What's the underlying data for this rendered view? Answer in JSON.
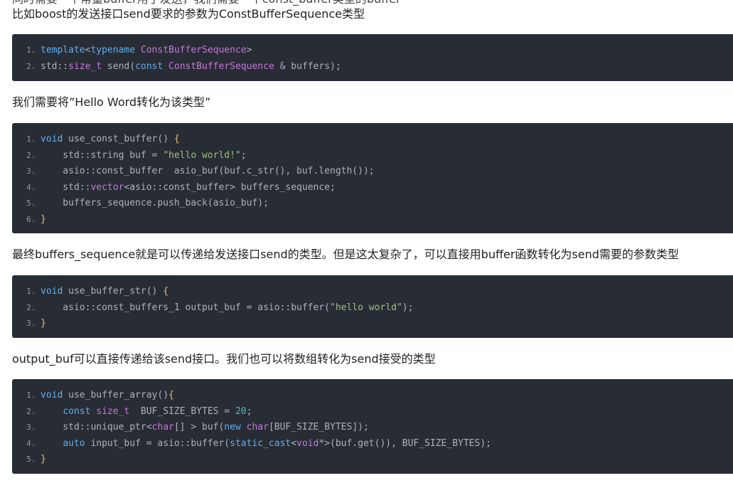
{
  "paragraphs": {
    "cut_top": "同时需要一个常量buffer用于发送，我们需要一个const_buffer类型的buffer",
    "p1": "比如boost的发送接口send要求的参数为ConstBufferSequence类型",
    "p2": "我们需要将”Hello Word转化为该类型”",
    "p3": "最终buffers_sequence就是可以传递给发送接口send的类型。但是这太复杂了，可以直接用buffer函数转化为send需要的参数类型",
    "p4": "output_buf可以直接传递给该send接口。我们也可以将数组转化为send接受的类型"
  },
  "code_blocks": [
    {
      "lines": [
        {
          "num": "1.",
          "parts": [
            [
              "kw",
              "template"
            ],
            [
              "op",
              "<"
            ],
            [
              "kw",
              "typename"
            ],
            [
              "op",
              " "
            ],
            [
              "ty",
              "ConstBufferSequence"
            ],
            [
              "op",
              ">"
            ]
          ]
        },
        {
          "num": "2.",
          "parts": [
            [
              "op",
              "std::"
            ],
            [
              "ty",
              "size_t"
            ],
            [
              "op",
              " send("
            ],
            [
              "kw",
              "const"
            ],
            [
              "op",
              " "
            ],
            [
              "ty",
              "ConstBufferSequence"
            ],
            [
              "op",
              " & buffers);"
            ]
          ]
        }
      ]
    },
    {
      "lines": [
        {
          "num": "1.",
          "parts": [
            [
              "kw",
              "void"
            ],
            [
              "op",
              " use_const_buffer() "
            ],
            [
              "br",
              "{"
            ]
          ]
        },
        {
          "num": "2.",
          "parts": [
            [
              "op",
              "    std::string buf = "
            ],
            [
              "st",
              "\"hello world!\""
            ],
            [
              "op",
              ";"
            ]
          ]
        },
        {
          "num": "3.",
          "parts": [
            [
              "op",
              "    asio::const_buffer  asio_buf(buf.c_str(), buf.length());"
            ]
          ]
        },
        {
          "num": "4.",
          "parts": [
            [
              "op",
              "    std::"
            ],
            [
              "ty",
              "vector"
            ],
            [
              "op",
              "<asio::const_buffer> buffers_sequence;"
            ]
          ]
        },
        {
          "num": "5.",
          "parts": [
            [
              "op",
              "    buffers_sequence.push_back(asio_buf);"
            ]
          ]
        },
        {
          "num": "6.",
          "parts": [
            [
              "br",
              "}"
            ]
          ]
        }
      ]
    },
    {
      "lines": [
        {
          "num": "1.",
          "parts": [
            [
              "kw",
              "void"
            ],
            [
              "op",
              " use_buffer_str() "
            ],
            [
              "br",
              "{"
            ]
          ]
        },
        {
          "num": "2.",
          "parts": [
            [
              "op",
              "    asio::const_buffers_1 output_buf = asio::buffer("
            ],
            [
              "st",
              "\"hello world\""
            ],
            [
              "op",
              ");"
            ]
          ]
        },
        {
          "num": "3.",
          "parts": [
            [
              "br",
              "}"
            ]
          ]
        }
      ]
    },
    {
      "lines": [
        {
          "num": "1.",
          "parts": [
            [
              "kw",
              "void"
            ],
            [
              "op",
              " use_buffer_array()"
            ],
            [
              "br",
              "{"
            ]
          ]
        },
        {
          "num": "2.",
          "parts": [
            [
              "op",
              "    "
            ],
            [
              "kw",
              "const"
            ],
            [
              "op",
              " "
            ],
            [
              "ty",
              "size_t"
            ],
            [
              "op",
              "  BUF_SIZE_BYTES = "
            ],
            [
              "nm",
              "20"
            ],
            [
              "op",
              ";"
            ]
          ]
        },
        {
          "num": "3.",
          "parts": [
            [
              "op",
              "    std::unique_ptr<"
            ],
            [
              "ty",
              "char"
            ],
            [
              "op",
              "[] > buf("
            ],
            [
              "kw",
              "new"
            ],
            [
              "op",
              " "
            ],
            [
              "ty",
              "char"
            ],
            [
              "op",
              "[BUF_SIZE_BYTES]);"
            ]
          ]
        },
        {
          "num": "4.",
          "parts": [
            [
              "op",
              "    "
            ],
            [
              "kw",
              "auto"
            ],
            [
              "op",
              " input_buf = asio::buffer("
            ],
            [
              "kw",
              "static_cast"
            ],
            [
              "op",
              "<"
            ],
            [
              "ty",
              "void"
            ],
            [
              "op",
              "*>(buf.get()), BUF_SIZE_BYTES);"
            ]
          ]
        },
        {
          "num": "5.",
          "parts": [
            [
              "br",
              "}"
            ]
          ]
        }
      ]
    }
  ]
}
